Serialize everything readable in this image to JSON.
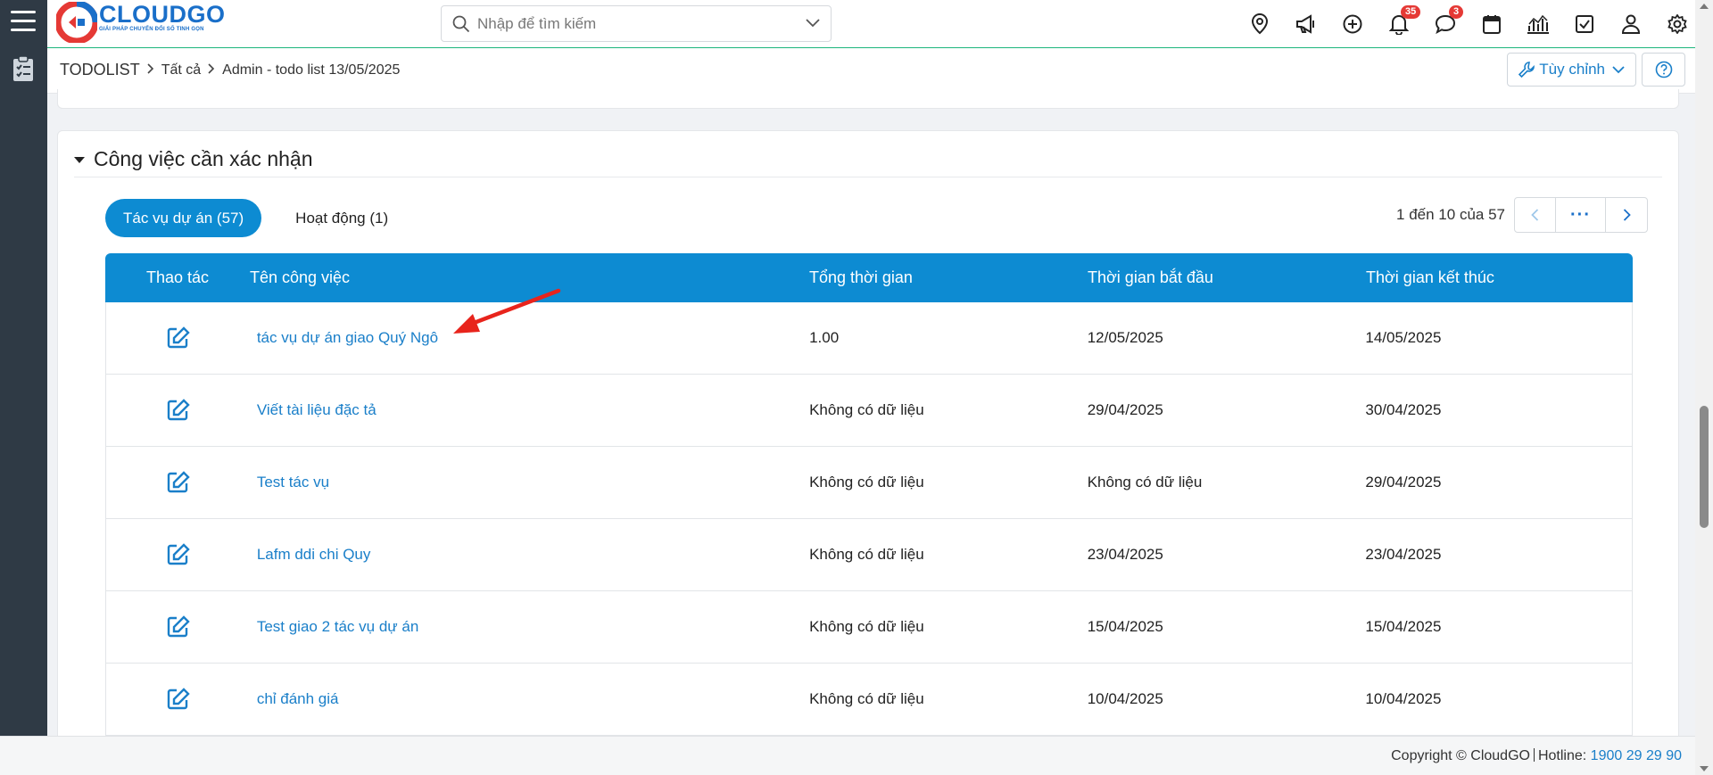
{
  "brand": {
    "name": "CLOUDGO",
    "tagline": "GIẢI PHÁP CHUYỂN ĐỔI SỐ TINH GỌN",
    "color": "#1a6fc9"
  },
  "search": {
    "placeholder": "Nhập để tìm kiếm"
  },
  "topbar": {
    "icons": [
      "location-pin-icon",
      "megaphone-icon",
      "plus-circle-icon",
      "bell-icon",
      "chat-icon",
      "calendar-icon",
      "chart-icon",
      "checkbox-icon",
      "user-icon",
      "gear-icon"
    ],
    "notifications_badge": "35",
    "messages_badge": "3"
  },
  "breadcrumb": {
    "root": "TODOLIST",
    "level1": "Tất cả",
    "level2": "Admin - todo list 13/05/2025"
  },
  "toolbar": {
    "customize_label": "Tùy chỉnh"
  },
  "section": {
    "title": "Công việc cần xác nhận",
    "tabs": [
      {
        "label": "Tác vụ dự án (57)",
        "active": true
      },
      {
        "label": "Hoạt động (1)",
        "active": false
      }
    ],
    "pager": {
      "info": "1 đến 10 của 57",
      "dots": "···"
    }
  },
  "table": {
    "headers": [
      "Thao tác",
      "Tên công việc",
      "Tổng thời gian",
      "Thời gian bắt đầu",
      "Thời gian kết thúc"
    ],
    "rows": [
      {
        "name": "tác vụ dự án giao Quý Ngô",
        "total": "1.00",
        "start": "12/05/2025",
        "end": "14/05/2025"
      },
      {
        "name": "Viết tài liệu đặc tả",
        "total": "Không có dữ liệu",
        "start": "29/04/2025",
        "end": "30/04/2025"
      },
      {
        "name": "Test tác vụ",
        "total": "Không có dữ liệu",
        "start": "Không có dữ liệu",
        "end": "29/04/2025"
      },
      {
        "name": "Lafm ddi chi Quy",
        "total": "Không có dữ liệu",
        "start": "23/04/2025",
        "end": "23/04/2025"
      },
      {
        "name": "Test giao 2 tác vụ dự án",
        "total": "Không có dữ liệu",
        "start": "15/04/2025",
        "end": "15/04/2025"
      },
      {
        "name": "chỉ đánh giá",
        "total": "Không có dữ liệu",
        "start": "10/04/2025",
        "end": "10/04/2025"
      }
    ]
  },
  "footer": {
    "copyright": "Copyright © CloudGO",
    "hotline_label": "Hotline:",
    "hotline": "1900 29 29 90"
  },
  "colors": {
    "accent": "#0d8bd2",
    "link": "#1a7fc9",
    "rail": "#2f3a45",
    "badge": "#e53935",
    "annotation": "#e8241c"
  }
}
